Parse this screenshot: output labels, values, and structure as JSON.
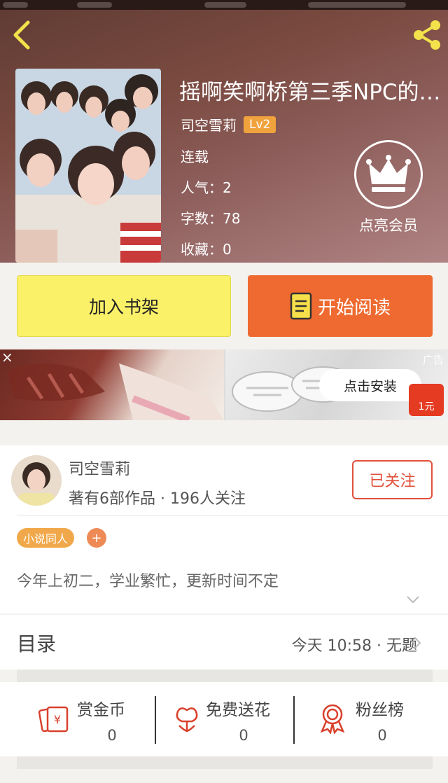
{
  "book": {
    "title": "摇啊笑啊桥第三季NPC的…",
    "author": "司空雪莉",
    "level": "Lv2",
    "status": "连载",
    "popularity": "人气：2",
    "word_count": "字数：78",
    "favorites": "收藏：0"
  },
  "member": {
    "label": "点亮会员"
  },
  "buttons": {
    "add_shelf": "加入书架",
    "start_read": "开始阅读"
  },
  "ad": {
    "tag": "广告",
    "install": "点击安装",
    "close": "×",
    "price": "1元"
  },
  "author_card": {
    "name": "司空雪莉",
    "stats": "著有6部作品 · 196人关注",
    "follow": "已关注",
    "tag": "小说同人",
    "tag_add": "+",
    "intro": "今年上初二，学业繁忙，更新时间不定"
  },
  "toc": {
    "title": "目录",
    "latest": "今天 10:58 · 无题"
  },
  "actions": [
    {
      "label": "赏金币",
      "count": "0",
      "icon": "gold-coin-icon"
    },
    {
      "label": "免费送花",
      "count": "0",
      "icon": "flower-icon"
    },
    {
      "label": "粉丝榜",
      "count": "0",
      "icon": "fan-ribbon-icon"
    }
  ],
  "colors": {
    "accent_orange": "#ee6a30",
    "shelf_yellow": "#faf169",
    "follow_red": "#e2503a",
    "badge_orange": "#f0a23c"
  }
}
